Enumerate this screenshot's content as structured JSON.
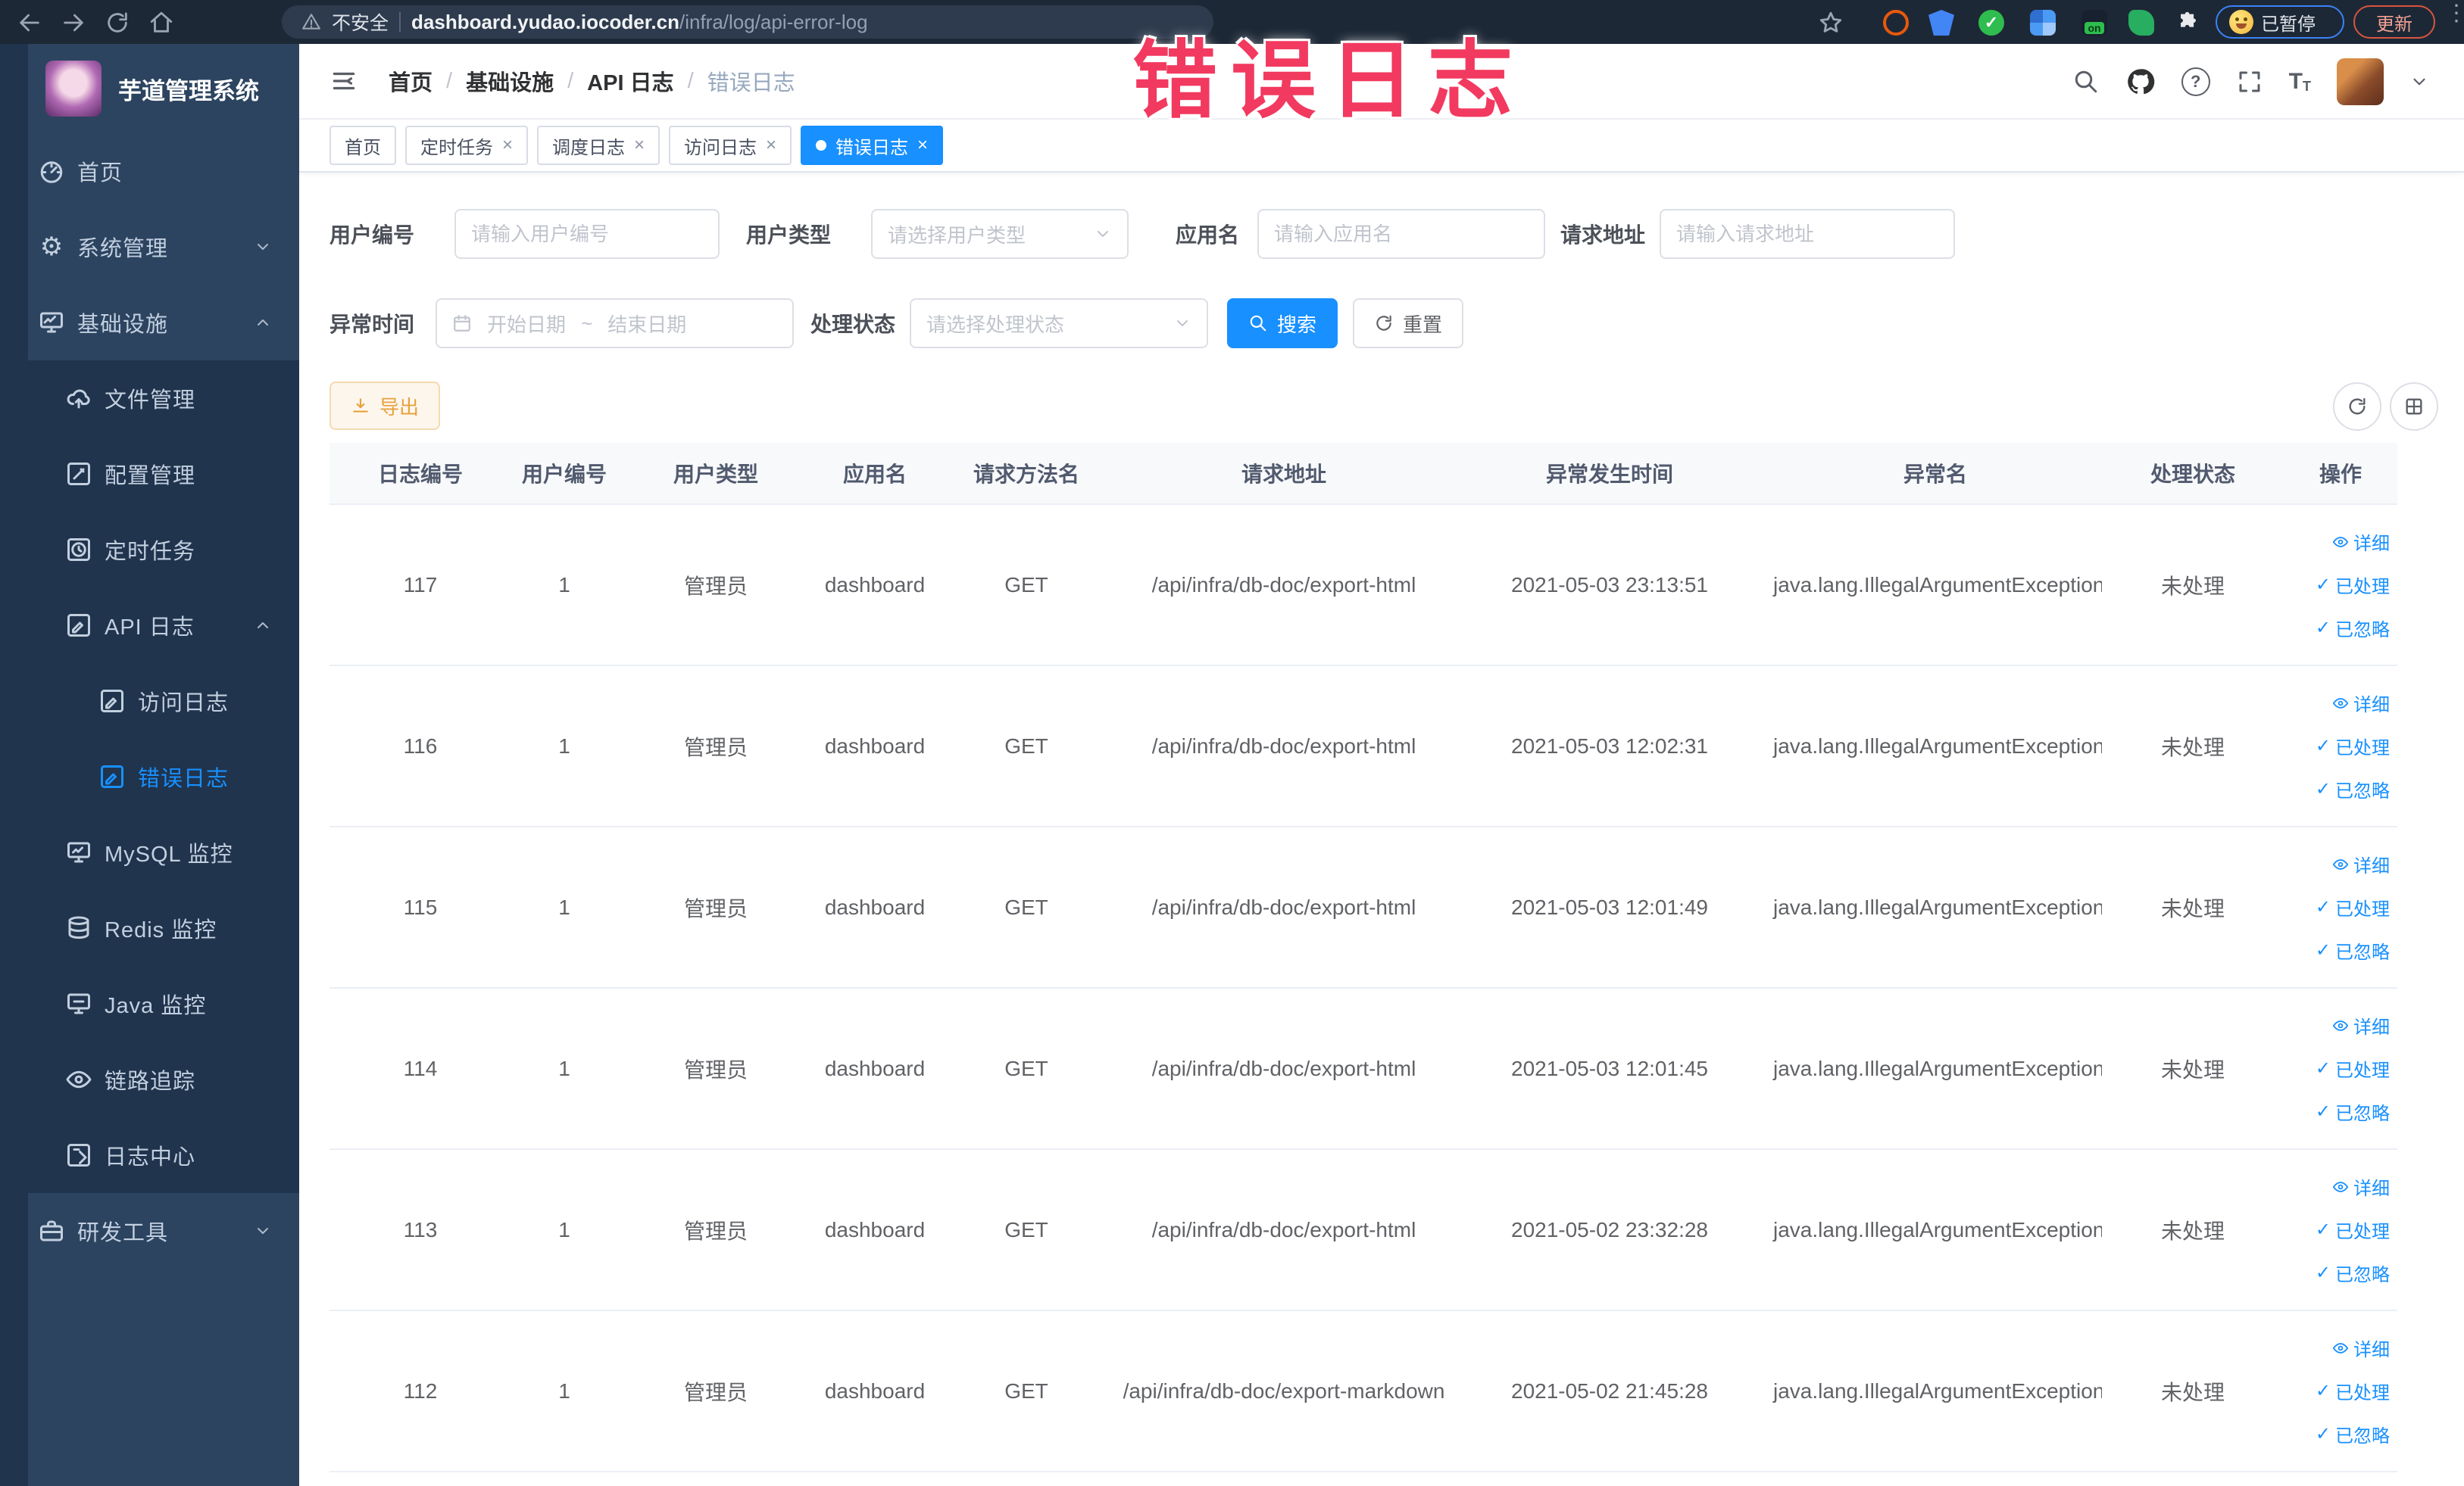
{
  "colors": {
    "accent": "#1890ff",
    "sidebar_bg": "#2c4460",
    "sidebar_sub_bg": "#20344d",
    "warning": "#e6a23c",
    "watermark": "#f2395f"
  },
  "watermark": "错误日志",
  "browser": {
    "security_label": "不安全",
    "url_host": "dashboard.yudao.iocoder.cn",
    "url_path": "/infra/log/api-error-log",
    "on_badge": "on",
    "paused_label": "已暂停",
    "update_label": "更新"
  },
  "sidebar": {
    "logo_title": "芋道管理系统",
    "home_label": "首页",
    "system_label": "系统管理",
    "infra_label": "基础设施",
    "file_label": "文件管理",
    "config_label": "配置管理",
    "job_label": "定时任务",
    "api_log_label": "API 日志",
    "access_log_label": "访问日志",
    "error_log_label": "错误日志",
    "mysql_label": "MySQL 监控",
    "redis_label": "Redis 监控",
    "java_label": "Java 监控",
    "trace_label": "链路追踪",
    "log_center_label": "日志中心",
    "dev_label": "研发工具"
  },
  "breadcrumb": {
    "items": [
      "首页",
      "基础设施",
      "API 日志",
      "错误日志"
    ]
  },
  "tabs": [
    {
      "label": "首页"
    },
    {
      "label": "定时任务"
    },
    {
      "label": "调度日志"
    },
    {
      "label": "访问日志"
    },
    {
      "label": "错误日志"
    }
  ],
  "close_glyph": "×",
  "filters": {
    "user_id_label": "用户编号",
    "user_id_placeholder": "请输入用户编号",
    "user_type_label": "用户类型",
    "user_type_placeholder": "请选择用户类型",
    "app_label": "应用名",
    "app_placeholder": "请输入应用名",
    "url_label": "请求地址",
    "url_placeholder": "请输入请求地址",
    "time_label": "异常时间",
    "time_start_placeholder": "开始日期",
    "time_separator": "~",
    "time_end_placeholder": "结束日期",
    "status_label": "处理状态",
    "status_placeholder": "请选择处理状态",
    "search_label": "搜索",
    "reset_label": "重置"
  },
  "toolbar": {
    "export_label": "导出"
  },
  "table": {
    "columns": [
      "日志编号",
      "用户编号",
      "用户类型",
      "应用名",
      "请求方法名",
      "请求地址",
      "异常发生时间",
      "异常名",
      "处理状态",
      "操作"
    ],
    "action_labels": {
      "detail": "详细",
      "processed": "已处理",
      "ignored": "已忽略"
    },
    "check_glyph": "✓",
    "rows": [
      {
        "log_id": "117",
        "user_id": "1",
        "user_type": "管理员",
        "app_name": "dashboard",
        "method": "GET",
        "url": "/api/infra/db-doc/export-html",
        "time": "2021-05-03 23:13:51",
        "exception": "java.lang.IllegalArgumentException",
        "status": "未处理"
      },
      {
        "log_id": "116",
        "user_id": "1",
        "user_type": "管理员",
        "app_name": "dashboard",
        "method": "GET",
        "url": "/api/infra/db-doc/export-html",
        "time": "2021-05-03 12:02:31",
        "exception": "java.lang.IllegalArgumentException",
        "status": "未处理"
      },
      {
        "log_id": "115",
        "user_id": "1",
        "user_type": "管理员",
        "app_name": "dashboard",
        "method": "GET",
        "url": "/api/infra/db-doc/export-html",
        "time": "2021-05-03 12:01:49",
        "exception": "java.lang.IllegalArgumentException",
        "status": "未处理"
      },
      {
        "log_id": "114",
        "user_id": "1",
        "user_type": "管理员",
        "app_name": "dashboard",
        "method": "GET",
        "url": "/api/infra/db-doc/export-html",
        "time": "2021-05-03 12:01:45",
        "exception": "java.lang.IllegalArgumentException",
        "status": "未处理"
      },
      {
        "log_id": "113",
        "user_id": "1",
        "user_type": "管理员",
        "app_name": "dashboard",
        "method": "GET",
        "url": "/api/infra/db-doc/export-html",
        "time": "2021-05-02 23:32:28",
        "exception": "java.lang.IllegalArgumentException",
        "status": "未处理"
      },
      {
        "log_id": "112",
        "user_id": "1",
        "user_type": "管理员",
        "app_name": "dashboard",
        "method": "GET",
        "url": "/api/infra/db-doc/export-markdown",
        "time": "2021-05-02 21:45:28",
        "exception": "java.lang.IllegalArgumentException",
        "status": "未处理"
      }
    ]
  }
}
